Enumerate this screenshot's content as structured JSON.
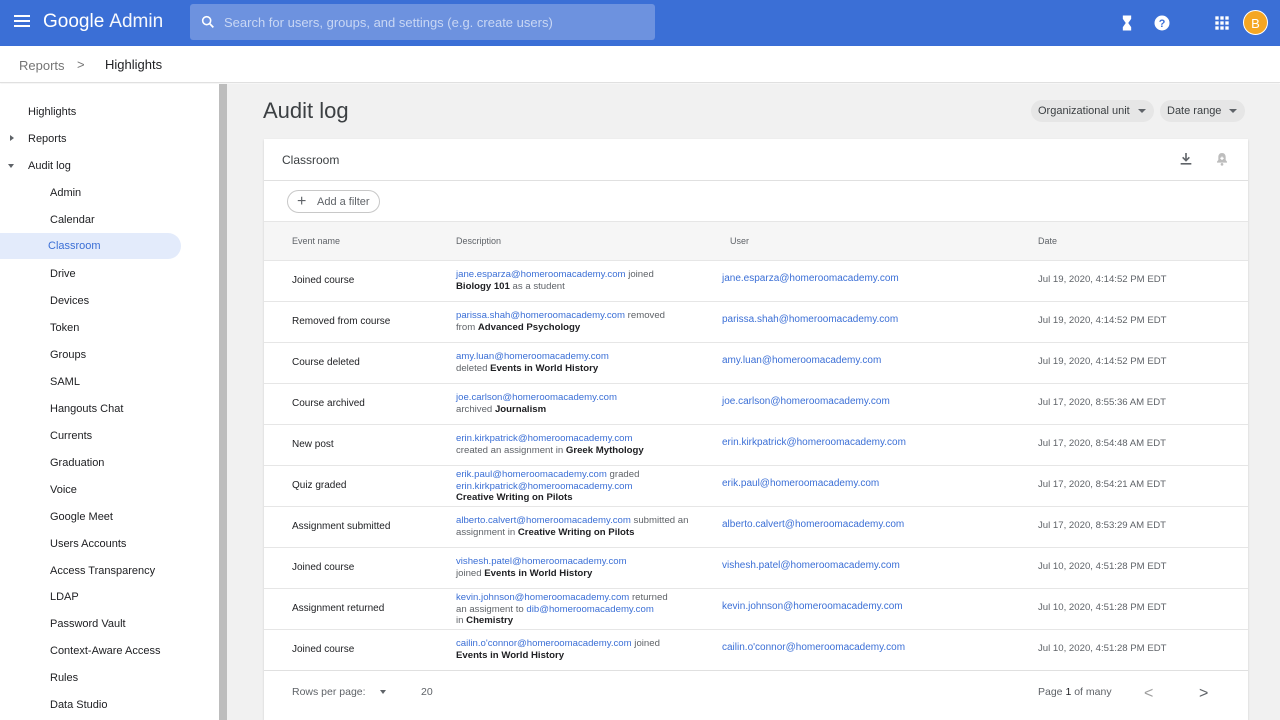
{
  "app": {
    "brand_google": "Google",
    "brand_admin": "Admin"
  },
  "search": {
    "placeholder": "Search for users, groups, and settings (e.g. create users)"
  },
  "topbar": {
    "avatar_letter": "B"
  },
  "breadcrumb": {
    "parent": "Reports",
    "separator": ">",
    "current": "Highlights"
  },
  "sidebar": {
    "items": [
      {
        "label": "Highlights"
      },
      {
        "label": "Reports"
      },
      {
        "label": "Audit log"
      },
      {
        "label": "Admin"
      },
      {
        "label": "Calendar"
      },
      {
        "label": "Classroom"
      },
      {
        "label": "Drive"
      },
      {
        "label": "Devices"
      },
      {
        "label": "Token"
      },
      {
        "label": "Groups"
      },
      {
        "label": "SAML"
      },
      {
        "label": "Hangouts Chat"
      },
      {
        "label": "Currents"
      },
      {
        "label": "Graduation"
      },
      {
        "label": "Voice"
      },
      {
        "label": "Google Meet"
      },
      {
        "label": "Users Accounts"
      },
      {
        "label": "Access Transparency"
      },
      {
        "label": "LDAP"
      },
      {
        "label": "Password Vault"
      },
      {
        "label": "Context-Aware Access"
      },
      {
        "label": "Rules"
      },
      {
        "label": "Data Studio"
      }
    ]
  },
  "main": {
    "title": "Audit log",
    "chips": {
      "org_unit": "Organizational unit",
      "date_range": "Date range"
    },
    "card_title": "Classroom",
    "add_filter": "Add a filter",
    "columns": {
      "event": "Event name",
      "description": "Description",
      "user": "User",
      "date": "Date"
    },
    "rows": [
      {
        "event": "Joined course",
        "user": "jane.esparza@homeroomacademy.com",
        "date": "Jul 19, 2020, 4:14:52 PM EDT",
        "d1": "jane.esparza@homeroomacademy.com",
        "d2": " joined",
        "d3": "Biology 101",
        "d4": " as a student"
      },
      {
        "event": "Removed from course",
        "user": "parissa.shah@homeroomacademy.com",
        "date": "Jul 19, 2020, 4:14:52 PM EDT",
        "d1": "parissa.shah@homeroomacademy.com",
        "d2": " removed",
        "d3": "from ",
        "d4": "Advanced Psychology"
      },
      {
        "event": "Course deleted",
        "user": "amy.luan@homeroomacademy.com",
        "date": "Jul 19, 2020, 4:14:52 PM EDT",
        "d1": "amy.luan@homeroomacademy.com",
        "d2": "deleted ",
        "d3": "Events in World History"
      },
      {
        "event": "Course archived",
        "user": "joe.carlson@homeroomacademy.com",
        "date": "Jul 17, 2020, 8:55:36 AM EDT",
        "d1": "joe.carlson@homeroomacademy.com",
        "d2": "archived ",
        "d3": "Journalism"
      },
      {
        "event": "New post",
        "user": "erin.kirkpatrick@homeroomacademy.com",
        "date": "Jul 17, 2020, 8:54:48 AM EDT",
        "d1": "erin.kirkpatrick@homeroomacademy.com",
        "d2": "created an assignment in ",
        "d3": "Greek Mythology"
      },
      {
        "event": "Quiz graded",
        "user": "erik.paul@homeroomacademy.com",
        "date": "Jul 17, 2020, 8:54:21 AM EDT",
        "d1": "erik.paul@homeroomacademy.com",
        "d2": " graded",
        "d3": "erin.kirkpatrick@homeroomacademy.com",
        "d4": "Creative Writing on Pilots"
      },
      {
        "event": "Assignment submitted",
        "user": "alberto.calvert@homeroomacademy.com",
        "date": "Jul 17, 2020, 8:53:29 AM EDT",
        "d1": "alberto.calvert@homeroomacademy.com",
        "d2": " submitted an",
        "d3": "assignment in ",
        "d4": "Creative Writing on Pilots"
      },
      {
        "event": "Joined course",
        "user": "vishesh.patel@homeroomacademy.com",
        "date": "Jul 10, 2020, 4:51:28 PM EDT",
        "d1": "vishesh.patel@homeroomacademy.com",
        "d2": "joined ",
        "d3": "Events in World History"
      },
      {
        "event": "Assignment returned",
        "user": "kevin.johnson@homeroomacademy.com",
        "date": "Jul 10, 2020, 4:51:28 PM EDT",
        "d1": "kevin.johnson@homeroomacademy.com",
        "d2": " returned",
        "d3": "an assigment to ",
        "d4": "dib@homeroomacademy.com",
        "d5": "in ",
        "d6": "Chemistry"
      },
      {
        "event": "Joined course",
        "user": "cailin.o'connor@homeroomacademy.com",
        "date": "Jul 10, 2020, 4:51:28 PM EDT",
        "d1": "cailin.o'connor@homeroomacademy.com",
        "d2": " joined",
        "d3": "Events in World History"
      }
    ],
    "footer": {
      "rows_per_page_label": "Rows per page:",
      "rows_per_page": "20",
      "page_word": "Page",
      "page_num": "1",
      "page_of": "of many",
      "prev": "<",
      "next": ">"
    }
  },
  "colors": {
    "topbar": "#3b6fd6",
    "link": "#3b6fd6",
    "avatar": "#f5a623",
    "active_nav": "#e3ebfb"
  }
}
